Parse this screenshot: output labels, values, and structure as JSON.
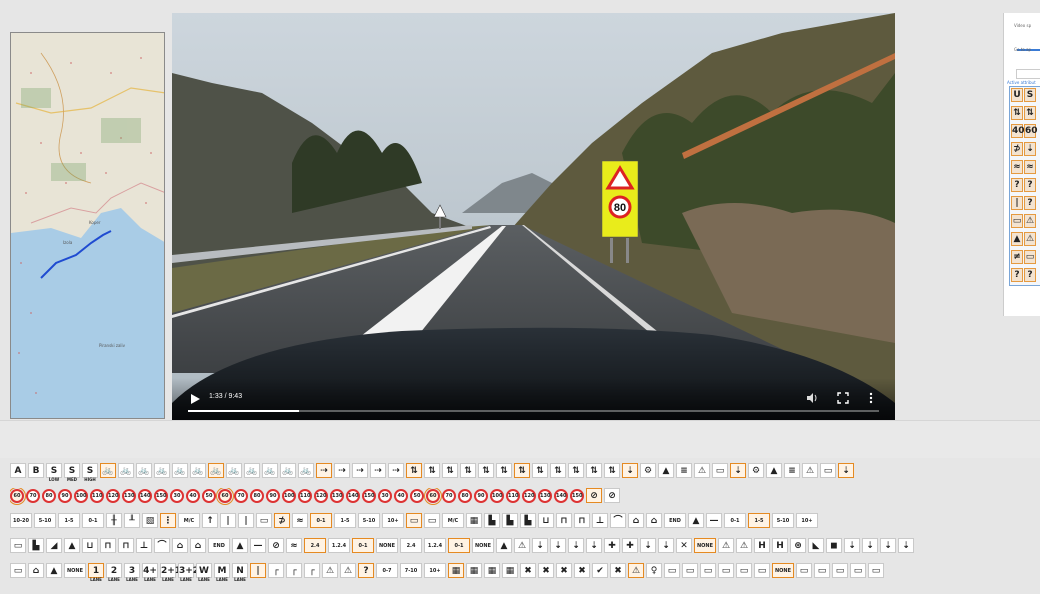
{
  "video": {
    "time": "1:33 / 9:43",
    "progress": 0.16,
    "road_sign": {
      "speed": "80"
    }
  },
  "map": {
    "labels": [
      "Koper",
      "Izola",
      "Piranski zaliv"
    ]
  },
  "side_panel": {
    "video_speed_label": "Video sp",
    "goto_label": "Go to ap",
    "active_label": "Active attribut",
    "grid": [
      [
        "U",
        "S"
      ],
      [
        "⇅",
        "⇅"
      ],
      [
        "40",
        "60"
      ],
      [
        "⊅",
        "⇣"
      ],
      [
        "≈",
        "≈"
      ],
      [
        "?",
        "?"
      ],
      [
        "|",
        "?"
      ],
      [
        "▭",
        "⚠"
      ],
      [
        "▲",
        "⚠"
      ],
      [
        "≠",
        "▭"
      ],
      [
        "?",
        "?"
      ]
    ]
  },
  "attribute_rows": [
    [
      {
        "t": "A",
        "s": false
      },
      {
        "t": "B",
        "s": false
      },
      {
        "t": "S",
        "sub": "LOW",
        "s": false
      },
      {
        "t": "S",
        "sub": "MED",
        "s": false
      },
      {
        "t": "S",
        "sub": "HIGH",
        "s": false
      },
      {
        "t": "🚲",
        "s": true
      },
      {
        "t": "🚲",
        "s": false
      },
      {
        "t": "🚲",
        "s": false
      },
      {
        "t": "🚲",
        "s": false
      },
      {
        "t": "🚲",
        "s": false
      },
      {
        "t": "🚲",
        "s": false
      },
      {
        "t": "🚲",
        "s": true
      },
      {
        "t": "🚲",
        "s": false
      },
      {
        "t": "🚲",
        "s": false
      },
      {
        "t": "🚲",
        "s": false
      },
      {
        "t": "🚲",
        "s": false
      },
      {
        "t": "🚲",
        "s": false
      },
      {
        "t": "⇢",
        "s": true
      },
      {
        "t": "⇢",
        "s": false
      },
      {
        "t": "⇢",
        "s": false
      },
      {
        "t": "⇢",
        "s": false
      },
      {
        "t": "⇢",
        "s": false
      },
      {
        "t": "⇅",
        "s": true
      },
      {
        "t": "⇅",
        "s": false
      },
      {
        "t": "⇅",
        "s": false
      },
      {
        "t": "⇅",
        "s": false
      },
      {
        "t": "⇅",
        "s": false
      },
      {
        "t": "⇅",
        "s": false
      },
      {
        "t": "⇅",
        "s": true
      },
      {
        "t": "⇅",
        "s": false
      },
      {
        "t": "⇅",
        "s": false
      },
      {
        "t": "⇅",
        "s": false
      },
      {
        "t": "⇅",
        "s": false
      },
      {
        "t": "⇅",
        "s": false
      },
      {
        "t": "⇣",
        "s": true
      },
      {
        "t": "⚙",
        "s": false
      },
      {
        "t": "▲",
        "s": false
      },
      {
        "t": "≡",
        "s": false
      },
      {
        "t": "⚠",
        "s": false
      },
      {
        "t": "▭",
        "s": false
      },
      {
        "t": "⇣",
        "s": true
      },
      {
        "t": "⚙",
        "s": false
      },
      {
        "t": "▲",
        "s": false
      },
      {
        "t": "≡",
        "s": false
      },
      {
        "t": "⚠",
        "s": false
      },
      {
        "t": "▭",
        "s": false
      },
      {
        "t": "⇣",
        "s": true
      }
    ],
    [
      {
        "t": "60",
        "r": true,
        "s": true
      },
      {
        "t": "70",
        "r": true,
        "s": false
      },
      {
        "t": "80",
        "r": true,
        "s": false
      },
      {
        "t": "90",
        "r": true,
        "s": false
      },
      {
        "t": "100",
        "r": true,
        "s": false
      },
      {
        "t": "110",
        "r": true,
        "s": false
      },
      {
        "t": "120",
        "r": true,
        "s": false
      },
      {
        "t": "130",
        "r": true,
        "s": false
      },
      {
        "t": "140",
        "r": true,
        "s": false
      },
      {
        "t": "150",
        "r": true,
        "s": false
      },
      {
        "t": "30",
        "r": true,
        "s": false
      },
      {
        "t": "40",
        "r": true,
        "s": false
      },
      {
        "t": "50",
        "r": true,
        "s": false
      },
      {
        "t": "60",
        "r": true,
        "s": true
      },
      {
        "t": "70",
        "r": true,
        "s": false
      },
      {
        "t": "80",
        "r": true,
        "s": false
      },
      {
        "t": "90",
        "r": true,
        "s": false
      },
      {
        "t": "100",
        "r": true,
        "s": false
      },
      {
        "t": "110",
        "r": true,
        "s": false
      },
      {
        "t": "120",
        "r": true,
        "s": false
      },
      {
        "t": "130",
        "r": true,
        "s": false
      },
      {
        "t": "140",
        "r": true,
        "s": false
      },
      {
        "t": "150",
        "r": true,
        "s": false
      },
      {
        "t": "30",
        "r": true,
        "s": false
      },
      {
        "t": "40",
        "r": true,
        "s": false
      },
      {
        "t": "50",
        "r": true,
        "s": false
      },
      {
        "t": "60",
        "r": true,
        "s": true
      },
      {
        "t": "70",
        "r": true,
        "s": false
      },
      {
        "t": "80",
        "r": true,
        "s": false
      },
      {
        "t": "90",
        "r": true,
        "s": false
      },
      {
        "t": "100",
        "r": true,
        "s": false
      },
      {
        "t": "110",
        "r": true,
        "s": false
      },
      {
        "t": "120",
        "r": true,
        "s": false
      },
      {
        "t": "130",
        "r": true,
        "s": false
      },
      {
        "t": "140",
        "r": true,
        "s": false
      },
      {
        "t": "150",
        "r": true,
        "s": false
      },
      {
        "t": "⊘",
        "s": true
      },
      {
        "t": "⊘",
        "s": false
      }
    ],
    [
      {
        "t": "10-20",
        "w": true,
        "s": false
      },
      {
        "t": "5-10",
        "w": true,
        "s": false
      },
      {
        "t": "1-5",
        "w": true,
        "s": false
      },
      {
        "t": "0-1",
        "w": true,
        "s": false
      },
      {
        "t": "╫",
        "s": false
      },
      {
        "t": "╨",
        "s": false
      },
      {
        "t": "▧",
        "s": false
      },
      {
        "t": "⋮",
        "s": true
      },
      {
        "t": "M/C",
        "w": true,
        "s": false
      },
      {
        "t": "↑",
        "s": false
      },
      {
        "t": "|",
        "s": false
      },
      {
        "t": "|",
        "s": false
      },
      {
        "t": "▭",
        "s": false
      },
      {
        "t": "⊅",
        "s": true
      },
      {
        "t": "≈",
        "s": false
      },
      {
        "t": "0-1",
        "w": true,
        "s": true
      },
      {
        "t": "1-5",
        "w": true,
        "s": false
      },
      {
        "t": "5-10",
        "w": true,
        "s": false
      },
      {
        "t": "10+",
        "w": true,
        "s": false
      },
      {
        "t": "▭",
        "s": true
      },
      {
        "t": "▭",
        "s": false
      },
      {
        "t": "M/C",
        "w": true,
        "s": false
      },
      {
        "t": "▦",
        "s": false
      },
      {
        "t": "▙",
        "s": false
      },
      {
        "t": "▙",
        "s": false
      },
      {
        "t": "▙",
        "s": false
      },
      {
        "t": "⊔",
        "s": false
      },
      {
        "t": "⊓",
        "s": false
      },
      {
        "t": "⊓",
        "s": false
      },
      {
        "t": "⊥",
        "s": false
      },
      {
        "t": "⌒",
        "s": false
      },
      {
        "t": "⌂",
        "s": false
      },
      {
        "t": "⌂",
        "s": false
      },
      {
        "t": "END",
        "w": true,
        "s": false
      },
      {
        "t": "▲",
        "s": false
      },
      {
        "t": "—",
        "s": false
      },
      {
        "t": "0-1",
        "w": true,
        "s": false
      },
      {
        "t": "1-5",
        "w": true,
        "s": true
      },
      {
        "t": "5-10",
        "w": true,
        "s": false
      },
      {
        "t": "10+",
        "w": true,
        "s": false
      }
    ],
    [
      {
        "t": "▭",
        "s": false
      },
      {
        "t": "▙",
        "s": false
      },
      {
        "t": "◢",
        "s": false
      },
      {
        "t": "▲",
        "s": false
      },
      {
        "t": "⊔",
        "s": false
      },
      {
        "t": "⊓",
        "s": false
      },
      {
        "t": "⊓",
        "s": false
      },
      {
        "t": "⊥",
        "s": false
      },
      {
        "t": "⌒",
        "s": false
      },
      {
        "t": "⌂",
        "s": false
      },
      {
        "t": "⌂",
        "s": false
      },
      {
        "t": "END",
        "w": true,
        "s": false
      },
      {
        "t": "▲",
        "s": false
      },
      {
        "t": "—",
        "s": false
      },
      {
        "t": "⊘",
        "s": false
      },
      {
        "t": "≈",
        "s": false
      },
      {
        "t": "2.4",
        "w": true,
        "s": true
      },
      {
        "t": "1.2.4",
        "w": true,
        "s": false
      },
      {
        "t": "0-1",
        "w": true,
        "s": true
      },
      {
        "t": "NONE",
        "w": true,
        "s": false
      },
      {
        "t": "2.4",
        "w": true,
        "s": false
      },
      {
        "t": "1.2.4",
        "w": true,
        "s": false
      },
      {
        "t": "0-1",
        "w": true,
        "s": true
      },
      {
        "t": "NONE",
        "w": true,
        "s": false
      },
      {
        "t": "▲",
        "s": false
      },
      {
        "t": "⚠",
        "s": false
      },
      {
        "t": "⇣",
        "s": false
      },
      {
        "t": "⇣",
        "s": false
      },
      {
        "t": "⇣",
        "s": false
      },
      {
        "t": "⇣",
        "s": false
      },
      {
        "t": "✚",
        "s": false
      },
      {
        "t": "✚",
        "s": false
      },
      {
        "t": "⇣",
        "s": false
      },
      {
        "t": "⇣",
        "s": false
      },
      {
        "t": "✕",
        "s": false
      },
      {
        "t": "NONE",
        "w": true,
        "s": true
      },
      {
        "t": "⚠",
        "s": false
      },
      {
        "t": "⚠",
        "s": false
      },
      {
        "t": "H",
        "s": false
      },
      {
        "t": "H",
        "s": false
      },
      {
        "t": "⊛",
        "s": false
      },
      {
        "t": "◣",
        "s": false
      },
      {
        "t": "◼",
        "s": false
      },
      {
        "t": "⇣",
        "s": false
      },
      {
        "t": "⇣",
        "s": false
      },
      {
        "t": "⇣",
        "s": false
      },
      {
        "t": "⇣",
        "s": false
      }
    ],
    [
      {
        "t": "▭",
        "s": false
      },
      {
        "t": "⌂",
        "s": false
      },
      {
        "t": "▲",
        "s": false
      },
      {
        "t": "NONE",
        "w": true,
        "s": false
      },
      {
        "t": "1",
        "sub": "LANE",
        "s": true
      },
      {
        "t": "2",
        "sub": "LANE",
        "s": false
      },
      {
        "t": "3",
        "sub": "LANE",
        "s": false
      },
      {
        "t": "4+",
        "sub": "LANE",
        "s": false
      },
      {
        "t": "2+1",
        "sub": "LANE",
        "s": false
      },
      {
        "t": "3+2",
        "sub": "LANE",
        "s": false
      },
      {
        "t": "W",
        "sub": "LANE",
        "s": false
      },
      {
        "t": "M",
        "sub": "LANE",
        "s": false
      },
      {
        "t": "N",
        "sub": "LANE",
        "s": false
      },
      {
        "t": "|",
        "s": true
      },
      {
        "t": "┌",
        "s": false
      },
      {
        "t": "┌",
        "s": false
      },
      {
        "t": "┌",
        "s": false
      },
      {
        "t": "⚠",
        "s": false
      },
      {
        "t": "⚠",
        "s": false
      },
      {
        "t": "?",
        "s": true
      },
      {
        "t": "0-7",
        "w": true,
        "s": false
      },
      {
        "t": "7-10",
        "w": true,
        "s": false
      },
      {
        "t": "10+",
        "w": true,
        "s": false
      },
      {
        "t": "▦",
        "s": true
      },
      {
        "t": "▦",
        "s": false
      },
      {
        "t": "▦",
        "s": false
      },
      {
        "t": "▦",
        "s": false
      },
      {
        "t": "✖",
        "s": false
      },
      {
        "t": "✖",
        "s": false
      },
      {
        "t": "✖",
        "s": false
      },
      {
        "t": "✖",
        "s": false
      },
      {
        "t": "✔",
        "s": false
      },
      {
        "t": "✖",
        "s": false
      },
      {
        "t": "⚠",
        "s": true
      },
      {
        "t": "♀",
        "s": false
      },
      {
        "t": "▭",
        "s": false
      },
      {
        "t": "▭",
        "s": false
      },
      {
        "t": "▭",
        "s": false
      },
      {
        "t": "▭",
        "s": false
      },
      {
        "t": "▭",
        "s": false
      },
      {
        "t": "▭",
        "s": false
      },
      {
        "t": "NONE",
        "w": true,
        "s": true
      },
      {
        "t": "▭",
        "s": false
      },
      {
        "t": "▭",
        "s": false
      },
      {
        "t": "▭",
        "s": false
      },
      {
        "t": "▭",
        "s": false
      },
      {
        "t": "▭",
        "s": false
      }
    ]
  ]
}
